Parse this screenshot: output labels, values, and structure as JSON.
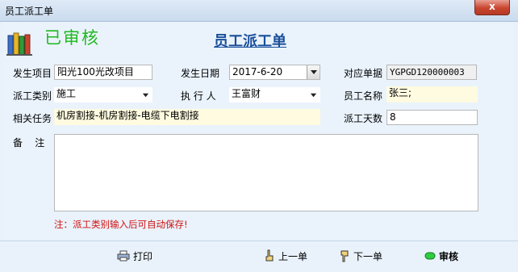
{
  "window": {
    "title": "员工派工单",
    "close_label": "x"
  },
  "status_stamp": "已审核",
  "page_title": "员工派工单",
  "fields": {
    "project_label": "发生项目",
    "project_value": "阳光100光改项目",
    "date_label": "发生日期",
    "date_value": "2017-6-20",
    "doc_label": "对应单据",
    "doc_value": "YGPGD120000003",
    "type_label": "派工类别",
    "type_value": "施工",
    "executor_label": "执 行 人",
    "executor_value": "王富财",
    "employee_label": "员工名称",
    "employee_value": "张三;",
    "task_label": "相关任务",
    "task_value": "机房割接-机房割接-电缆下电割接",
    "days_label": "派工天数",
    "days_value": "8",
    "remark_label": "备    注",
    "remark_value": ""
  },
  "note": "注：派工类别输入后可自动保存!",
  "buttons": {
    "print": "打印",
    "prev": "上一单",
    "next": "下一单",
    "audit": "审核"
  },
  "colors": {
    "status_green": "#1fb91f",
    "title_blue": "#1a4f9a",
    "note_red": "#d01010"
  }
}
